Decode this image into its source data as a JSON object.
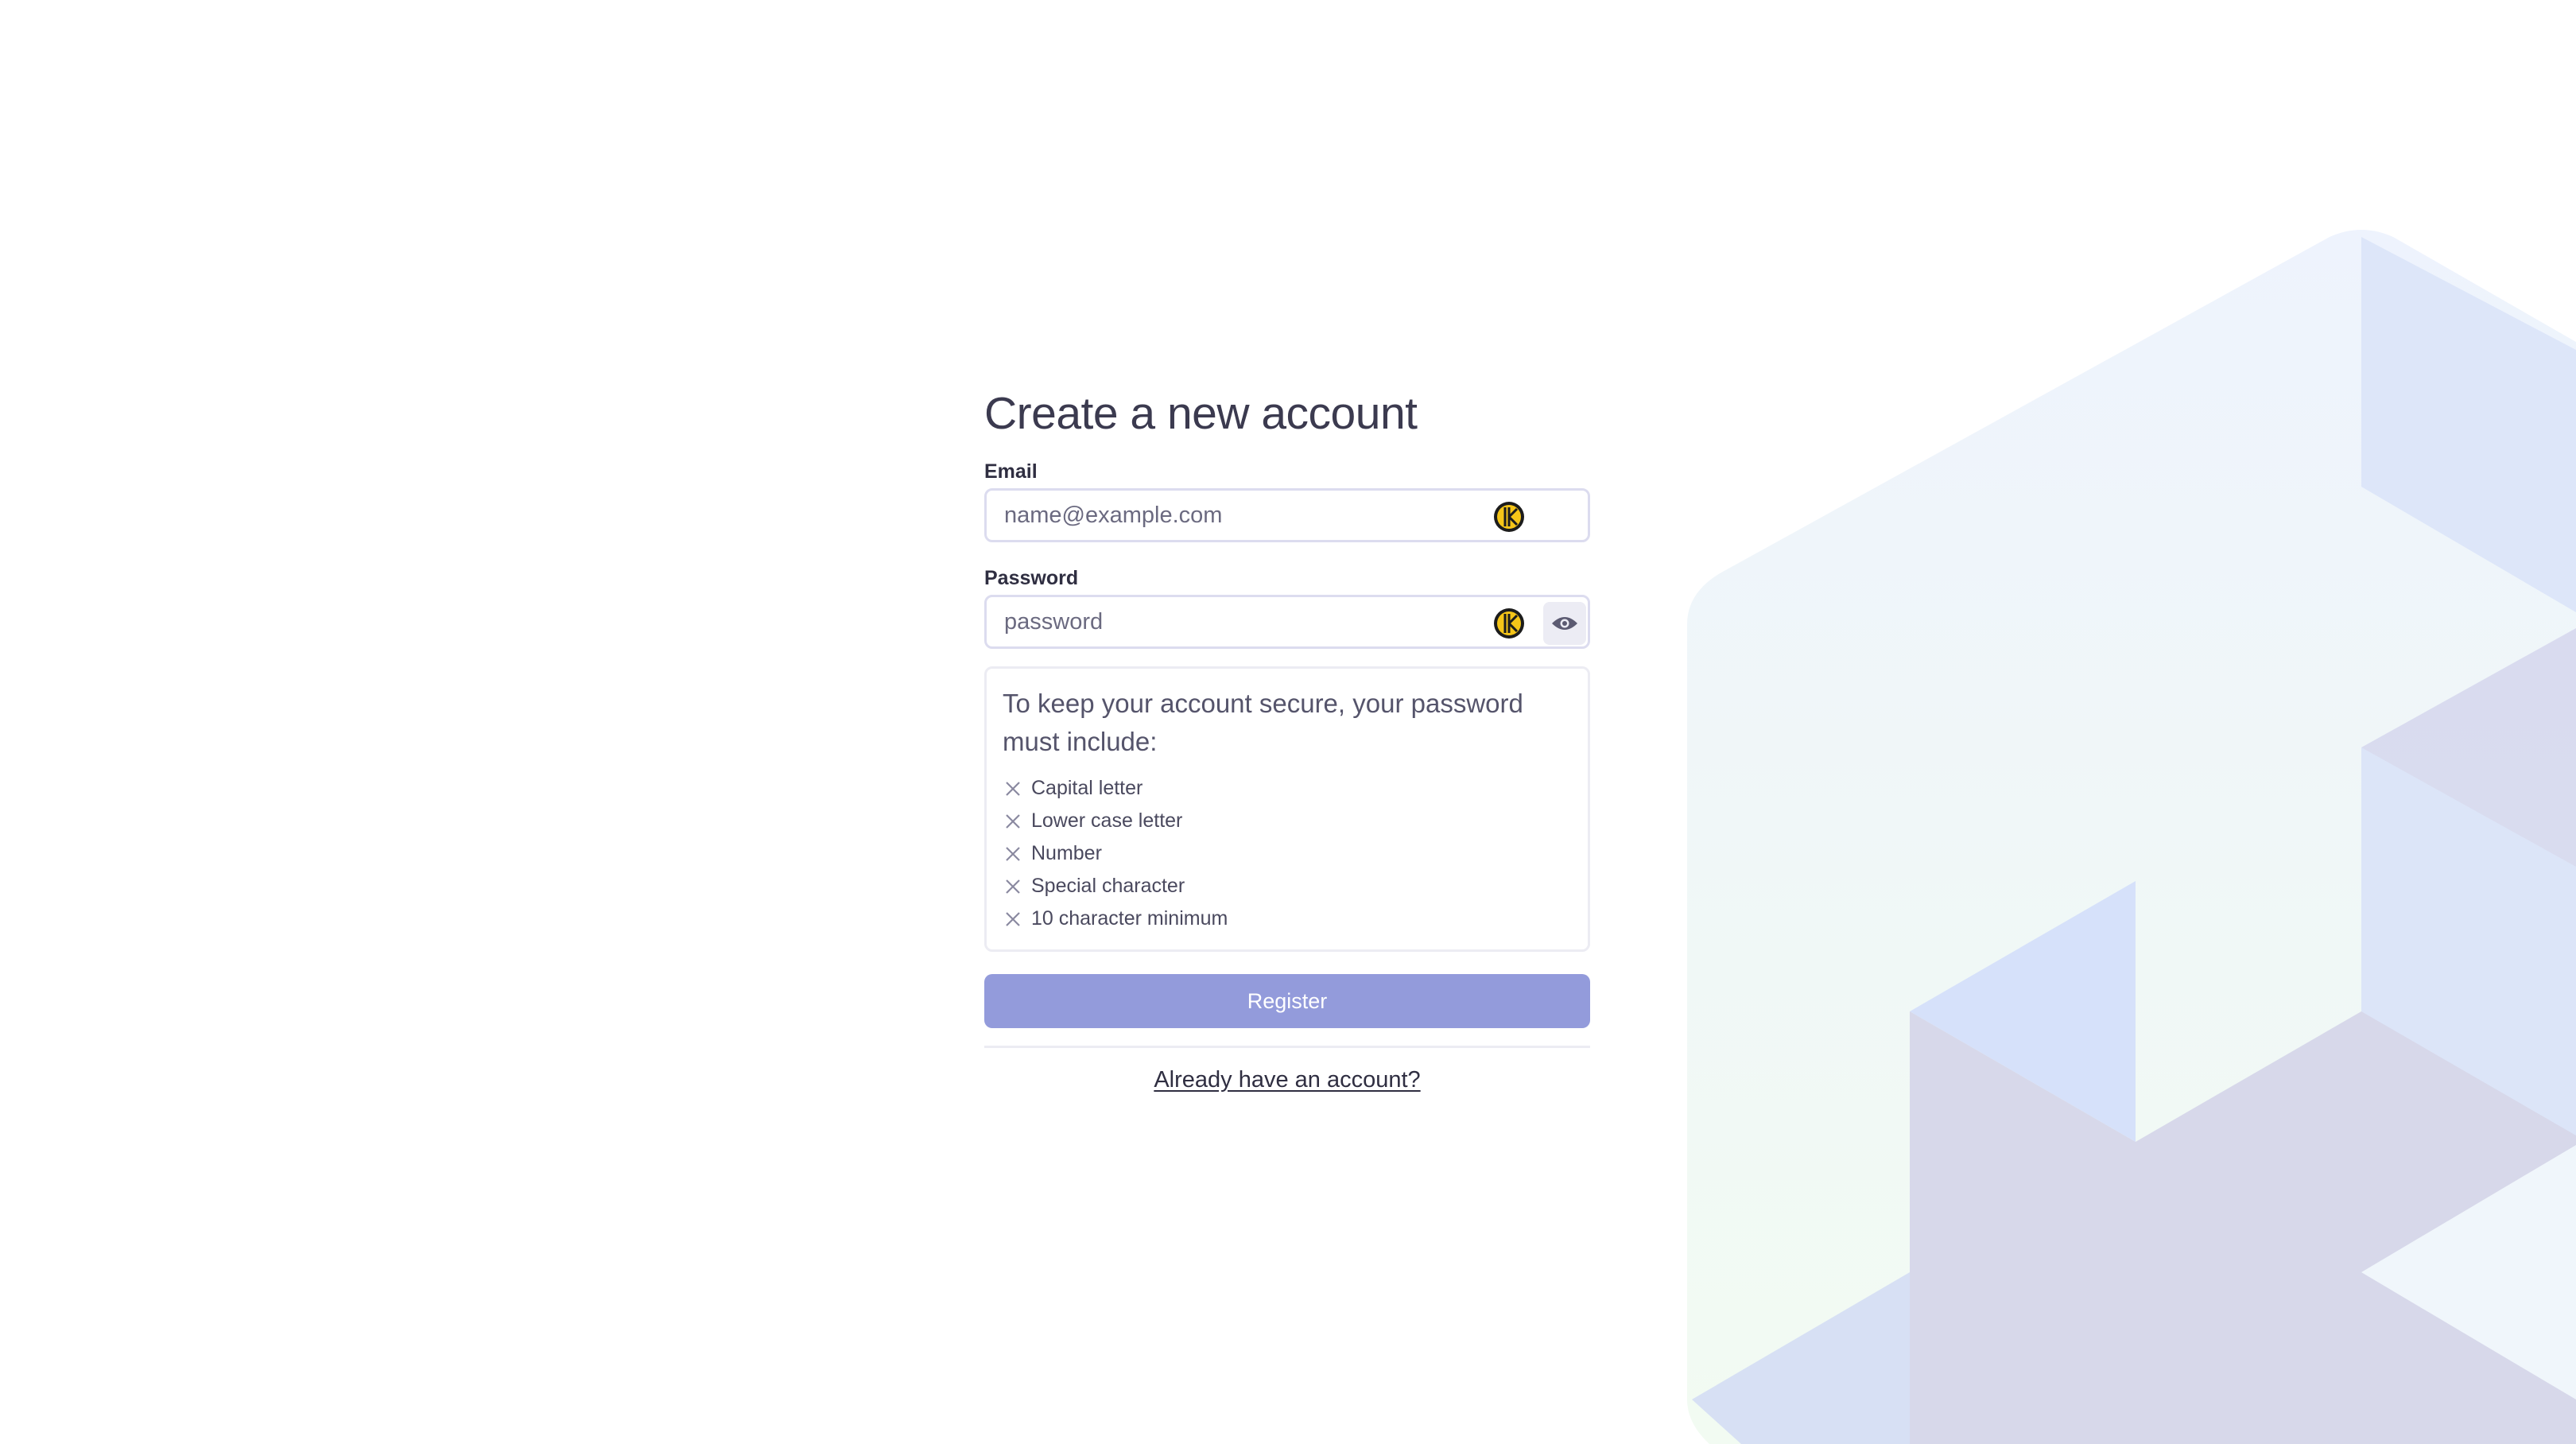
{
  "page": {
    "title": "Create a new account"
  },
  "email": {
    "label": "Email",
    "placeholder": "name@example.com",
    "value": ""
  },
  "password": {
    "label": "Password",
    "placeholder": "password",
    "value": "",
    "toggle_icon": "eye-icon"
  },
  "requirements": {
    "title": "To keep your account secure, your password must include:",
    "status_icon": "x-icon",
    "items": [
      {
        "label": "Capital letter",
        "met": false
      },
      {
        "label": "Lower case letter",
        "met": false
      },
      {
        "label": "Number",
        "met": false
      },
      {
        "label": "Special character",
        "met": false
      },
      {
        "label": "10 character minimum",
        "met": false
      }
    ]
  },
  "actions": {
    "register_label": "Register",
    "login_link_label": "Already have an account?"
  },
  "colors": {
    "primary_button": "#939bdb",
    "keeper_icon": "#f5c518",
    "input_border": "#dcdcef"
  }
}
